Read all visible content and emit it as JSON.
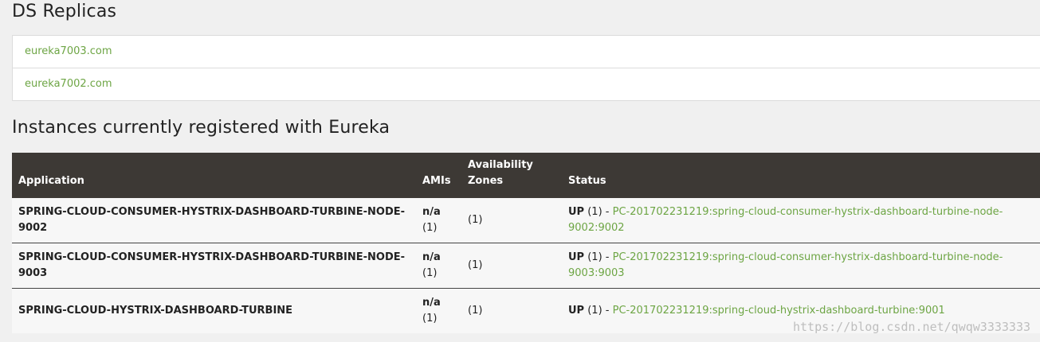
{
  "ds_replicas": {
    "title": "DS Replicas",
    "items": [
      "eureka7003.com",
      "eureka7002.com"
    ]
  },
  "instances": {
    "title": "Instances currently registered with Eureka",
    "headers": {
      "application": "Application",
      "amis": "AMIs",
      "zones": "Availability Zones",
      "status": "Status"
    },
    "rows": [
      {
        "application": "SPRING-CLOUD-CONSUMER-HYSTRIX-DASHBOARD-TURBINE-NODE-9002",
        "amis": "n/a",
        "amis_count": "(1)",
        "zones": "(1)",
        "status_state": "UP",
        "status_count": "(1) -",
        "status_link": "PC-201702231219:spring-cloud-consumer-hystrix-dashboard-turbine-node-9002:9002"
      },
      {
        "application": "SPRING-CLOUD-CONSUMER-HYSTRIX-DASHBOARD-TURBINE-NODE-9003",
        "amis": "n/a",
        "amis_count": "(1)",
        "zones": "(1)",
        "status_state": "UP",
        "status_count": "(1) -",
        "status_link": "PC-201702231219:spring-cloud-consumer-hystrix-dashboard-turbine-node-9003:9003"
      },
      {
        "application": "SPRING-CLOUD-HYSTRIX-DASHBOARD-TURBINE",
        "amis": "n/a",
        "amis_count": "(1)",
        "zones": "(1)",
        "status_state": "UP",
        "status_count": "(1) -",
        "status_link": "PC-201702231219:spring-cloud-hystrix-dashboard-turbine:9001"
      }
    ]
  },
  "watermark": "https://blog.csdn.net/qwqw3333333",
  "colors": {
    "link": "#6da544",
    "header_bg": "#3d3935"
  }
}
